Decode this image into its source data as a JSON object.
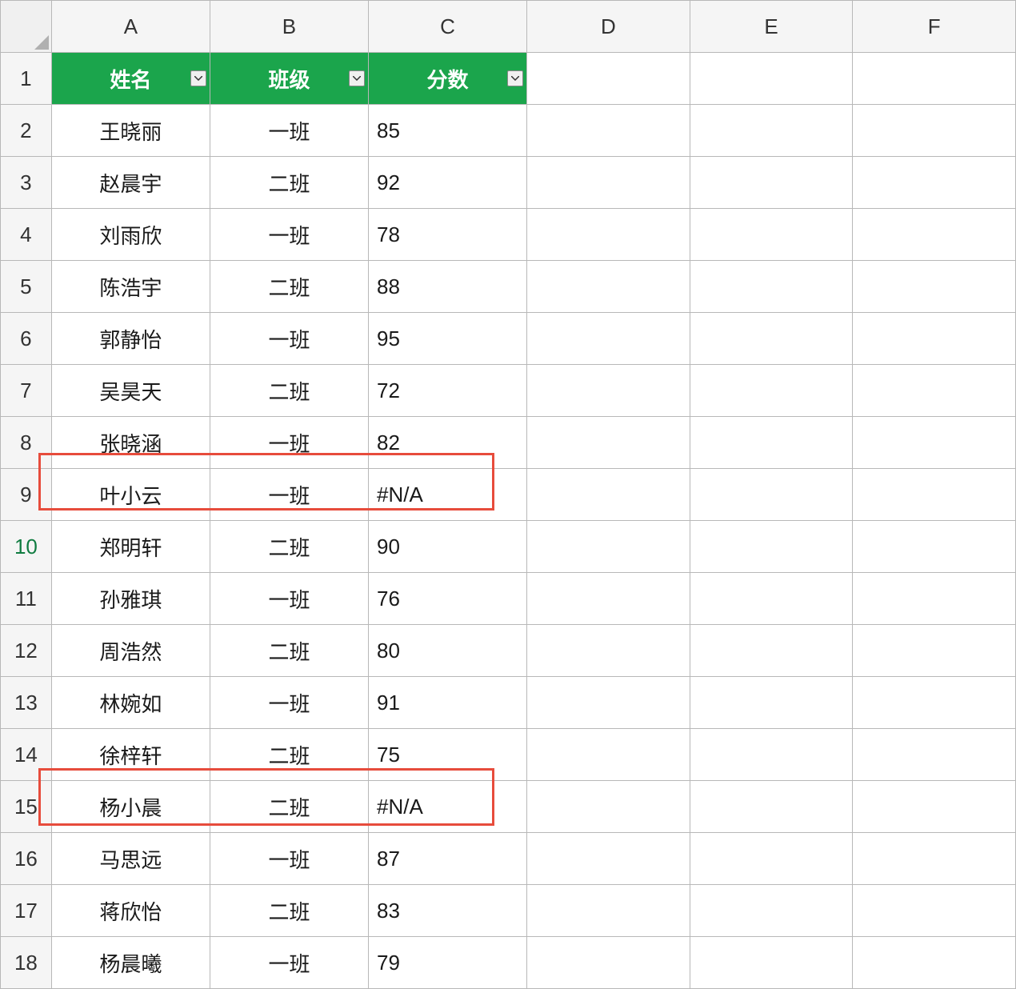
{
  "columns": [
    "A",
    "B",
    "C",
    "D",
    "E",
    "F"
  ],
  "rowNumbers": [
    "1",
    "2",
    "3",
    "4",
    "5",
    "6",
    "7",
    "8",
    "9",
    "10",
    "11",
    "12",
    "13",
    "14",
    "15",
    "16",
    "17",
    "18"
  ],
  "headers": {
    "name": "姓名",
    "class": "班级",
    "score": "分数"
  },
  "rows": [
    {
      "name": "王晓丽",
      "class": "一班",
      "score": "85"
    },
    {
      "name": "赵晨宇",
      "class": "二班",
      "score": "92"
    },
    {
      "name": "刘雨欣",
      "class": "一班",
      "score": "78"
    },
    {
      "name": "陈浩宇",
      "class": "二班",
      "score": "88"
    },
    {
      "name": "郭静怡",
      "class": "一班",
      "score": "95"
    },
    {
      "name": "吴昊天",
      "class": "二班",
      "score": "72"
    },
    {
      "name": "张晓涵",
      "class": "一班",
      "score": "82"
    },
    {
      "name": "叶小云",
      "class": "一班",
      "score": "#N/A"
    },
    {
      "name": "郑明轩",
      "class": "二班",
      "score": "90"
    },
    {
      "name": "孙雅琪",
      "class": "一班",
      "score": "76"
    },
    {
      "name": "周浩然",
      "class": "二班",
      "score": "80"
    },
    {
      "name": "林婉如",
      "class": "一班",
      "score": "91"
    },
    {
      "name": "徐梓轩",
      "class": "二班",
      "score": "75"
    },
    {
      "name": "杨小晨",
      "class": "二班",
      "score": "#N/A"
    },
    {
      "name": "马思远",
      "class": "一班",
      "score": "87"
    },
    {
      "name": "蒋欣怡",
      "class": "二班",
      "score": "83"
    },
    {
      "name": "杨晨曦",
      "class": "一班",
      "score": "79"
    }
  ],
  "highlightedRows": [
    9,
    15
  ],
  "selectedRowHeader": 10
}
